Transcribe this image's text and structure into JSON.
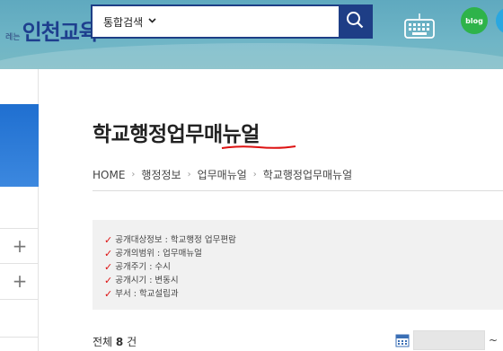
{
  "header": {
    "logo_small": "레는",
    "logo_text": "인천교육",
    "search": {
      "scope_label": "통합검색",
      "placeholder": ""
    },
    "blog_label": "blog"
  },
  "page": {
    "title": "학교행정업무매뉴얼",
    "breadcrumb": [
      "HOME",
      "행정정보",
      "업무매뉴얼",
      "학교행정업무매뉴얼"
    ]
  },
  "info": [
    "공개대상정보 : 학교행정 업무편람",
    "공개의범위 : 업무매뉴얼",
    "공개주기 : 수시",
    "공개시기 : 변동시",
    "부서 : 학교설립과"
  ],
  "list": {
    "total_prefix": "전체",
    "total_count": "8",
    "total_suffix": "건",
    "date_tilde": "~"
  },
  "colors": {
    "brand": "#1e3e86",
    "accent_red": "#dd1111",
    "blog": "#2eb34a"
  }
}
